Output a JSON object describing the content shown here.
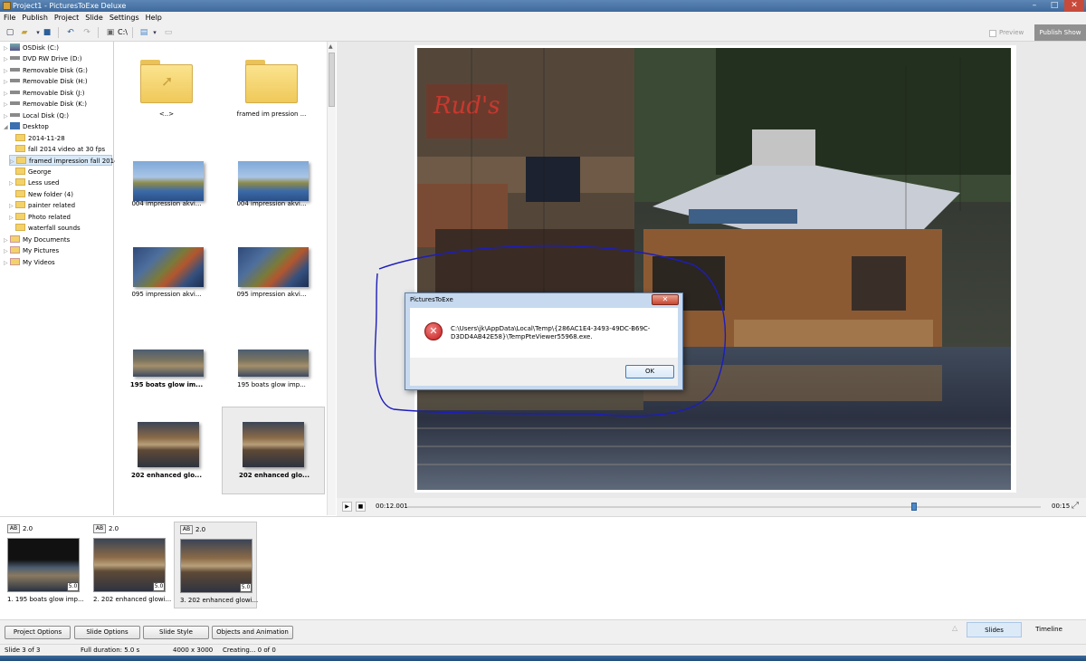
{
  "window": {
    "title": "Project1 - PicturesToExe Deluxe",
    "controls": [
      "–",
      "□",
      "✕"
    ]
  },
  "menu": [
    "File",
    "Publish",
    "Project",
    "Slide",
    "Settings",
    "Help"
  ],
  "toolbar": {
    "path_label": "C:\\",
    "preview_label": "Preview",
    "publish_label": "Publish Show"
  },
  "tree": [
    {
      "label": "OSDisk (C:)",
      "icon": "os-drive-icon",
      "level": 0
    },
    {
      "label": "DVD RW Drive (D:)",
      "icon": "dvd-drive-icon",
      "level": 0
    },
    {
      "label": "Removable Disk (G:)",
      "icon": "removable-disk-icon",
      "level": 0
    },
    {
      "label": "Removable Disk (H:)",
      "icon": "removable-disk-icon",
      "level": 0
    },
    {
      "label": "Removable Disk (J:)",
      "icon": "removable-disk-icon",
      "level": 0
    },
    {
      "label": "Removable Disk (K:)",
      "icon": "removable-disk-icon",
      "level": 0
    },
    {
      "label": "Local Disk (Q:)",
      "icon": "local-disk-icon",
      "level": 0
    },
    {
      "label": "Desktop",
      "icon": "desktop-icon",
      "level": 0
    },
    {
      "label": "2014-11-28",
      "icon": "folder-icon",
      "level": 1
    },
    {
      "label": "fall 2014 video at 30 fps",
      "icon": "folder-icon",
      "level": 1
    },
    {
      "label": "framed impression fall 2014",
      "icon": "folder-icon",
      "level": 1,
      "selected": true
    },
    {
      "label": "George",
      "icon": "folder-icon",
      "level": 1
    },
    {
      "label": "Less used",
      "icon": "folder-icon",
      "level": 1
    },
    {
      "label": "New folder (4)",
      "icon": "folder-icon",
      "level": 1
    },
    {
      "label": "painter related",
      "icon": "folder-icon",
      "level": 1
    },
    {
      "label": "Photo related",
      "icon": "folder-icon",
      "level": 1
    },
    {
      "label": "waterfall sounds",
      "icon": "folder-icon",
      "level": 1
    },
    {
      "label": "My Documents",
      "icon": "documents-icon",
      "level": 0
    },
    {
      "label": "My Pictures",
      "icon": "pictures-icon",
      "level": 0
    },
    {
      "label": "My Videos",
      "icon": "videos-icon",
      "level": 0
    }
  ],
  "files": [
    {
      "caption": "<..>",
      "kind": "folder-up"
    },
    {
      "caption": "framed im pression ...",
      "kind": "folder"
    },
    {
      "caption": "004 impression akvi...",
      "kind": "image"
    },
    {
      "caption": "004 impression akvi...",
      "kind": "image"
    },
    {
      "caption": "095 impression akvi...",
      "kind": "image"
    },
    {
      "caption": "095 impression akvi...",
      "kind": "image"
    },
    {
      "caption": "195 boats  glow im...",
      "kind": "image"
    },
    {
      "caption": "195 boats  glow imp...",
      "kind": "image"
    },
    {
      "caption": "202 enhanced glo...",
      "kind": "image"
    },
    {
      "caption": "202 enhanced glo...",
      "kind": "image"
    }
  ],
  "player": {
    "current_time": "00:12.001",
    "end_time": "00:15",
    "progress": 0.8
  },
  "dialog": {
    "title": "PicturesToExe",
    "message": "C:\\Users\\jk\\AppData\\Local\\Temp\\{286AC1E4-3493-49DC-B69C-D3DD4AB42E58}\\TempPteViewer55968.exe.",
    "ok_label": "OK",
    "close_label": "✕"
  },
  "slides": [
    {
      "ab": "AB",
      "transition": "2.0",
      "duration": "5.0",
      "name": "1. 195 boats  glow imp..."
    },
    {
      "ab": "AB",
      "transition": "2.0",
      "duration": "5.0",
      "name": "2. 202 enhanced glowi..."
    },
    {
      "ab": "AB",
      "transition": "2.0",
      "duration": "5.0",
      "name": "3. 202 enhanced glowi..."
    }
  ],
  "buttons": {
    "project_options": "Project Options",
    "slide_options": "Slide Options",
    "slide_style": "Slide Style",
    "objects_animation": "Objects and Animation",
    "slides_tab": "Slides",
    "timeline_tab": "Timeline"
  },
  "status": {
    "slide": "Slide 3 of 3",
    "duration": "Full duration: 5.0 s",
    "size": "4000 x 3000",
    "creating": "Creating... 0 of 0"
  },
  "colors": {
    "accent": "#3f6a9c",
    "annotation": "#1d1dbb",
    "error": "#c51b1b"
  }
}
